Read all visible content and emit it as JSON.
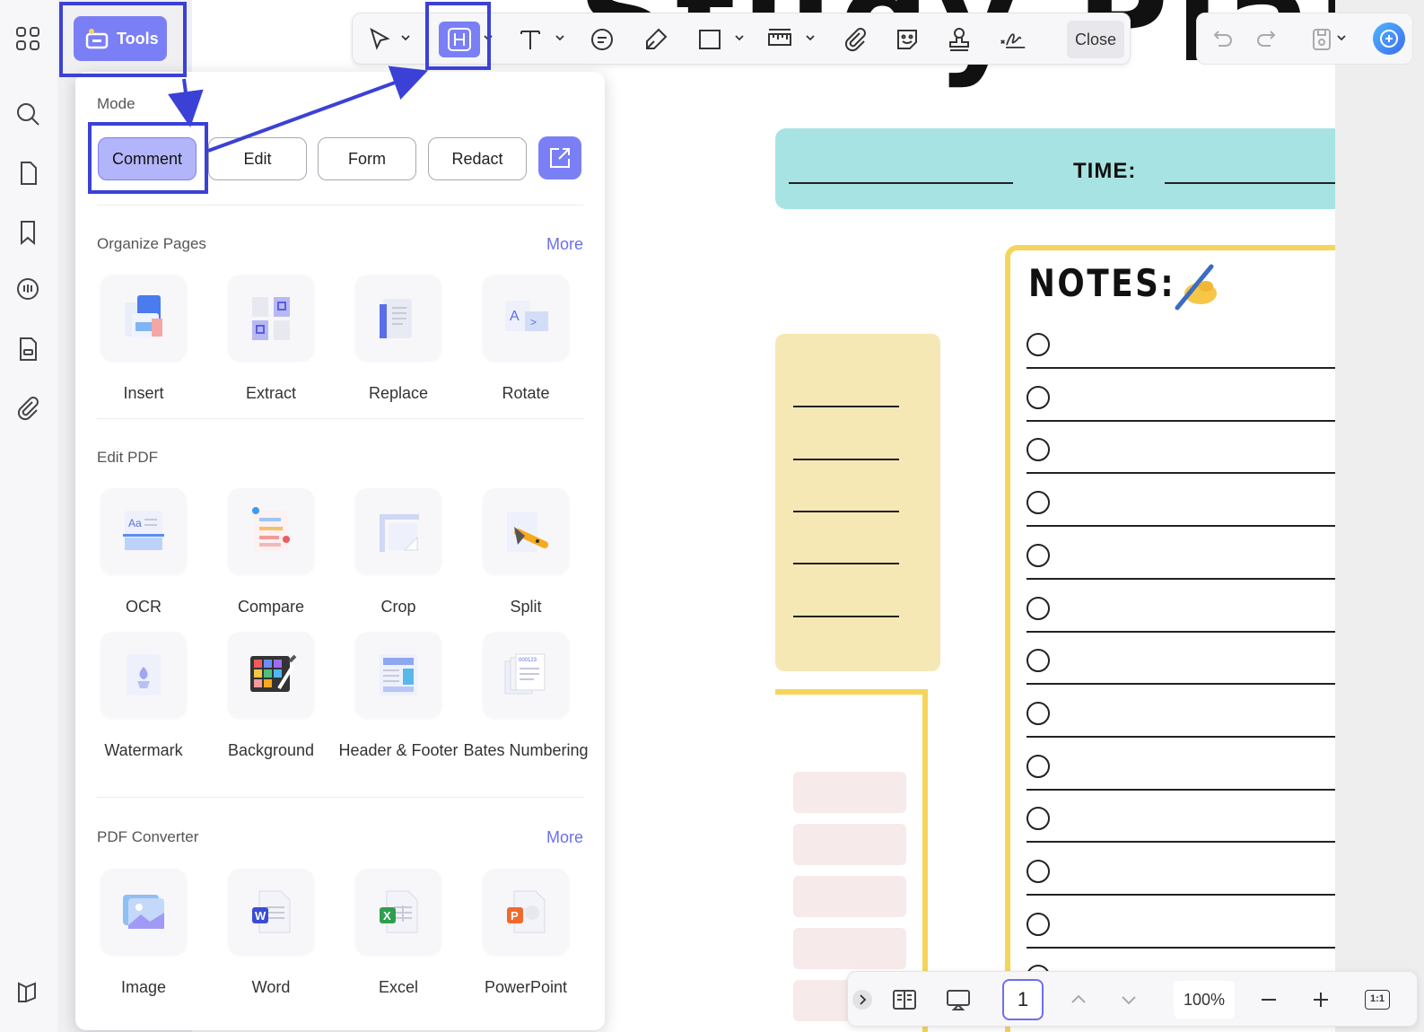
{
  "document": {
    "title_visible": "Study Planner",
    "time_label": "TIME:",
    "notes_title": "NOTES:",
    "note_rows": 13
  },
  "toolbar": {
    "close_label": "Close",
    "tools_label": "Tools",
    "tools_icon": "toolbox-icon",
    "annotation_tools": [
      "select-icon",
      "highlight-icon",
      "text-icon",
      "comment-icon",
      "pencil-icon",
      "rectangle-icon",
      "measure-icon",
      "attachment-icon",
      "sticker-icon",
      "stamp-icon",
      "signature-icon"
    ]
  },
  "tools_panel": {
    "mode": {
      "title": "Mode",
      "buttons": [
        "Comment",
        "Edit",
        "Form",
        "Redact"
      ],
      "selected": "Comment"
    },
    "organize": {
      "title": "Organize Pages",
      "more": "More",
      "items": [
        "Insert",
        "Extract",
        "Replace",
        "Rotate"
      ]
    },
    "edit_pdf": {
      "title": "Edit PDF",
      "items": [
        "OCR",
        "Compare",
        "Crop",
        "Split",
        "Watermark",
        "Background",
        "Header & Footer",
        "Bates Numbering"
      ]
    },
    "converter": {
      "title": "PDF Converter",
      "more": "More",
      "items": [
        "Image",
        "Word",
        "Excel",
        "PowerPoint"
      ]
    }
  },
  "bottom_bar": {
    "page": "1",
    "zoom": "100%",
    "fit_label": "1:1"
  },
  "colors": {
    "accent": "#7b7ff5",
    "annotation": "#3b41d6",
    "teal": "#a8e3e3",
    "yellow": "#f5d55a"
  }
}
